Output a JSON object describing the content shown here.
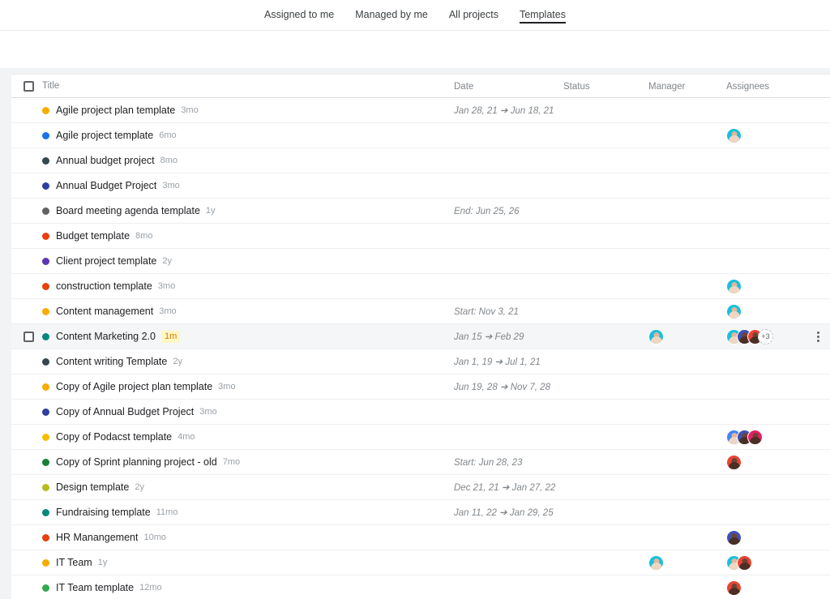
{
  "nav": {
    "tabs": [
      {
        "label": "Assigned to me",
        "active": false
      },
      {
        "label": "Managed by me",
        "active": false
      },
      {
        "label": "All projects",
        "active": false
      },
      {
        "label": "Templates",
        "active": true
      }
    ]
  },
  "table": {
    "columns": {
      "title": "Title",
      "date": "Date",
      "status": "Status",
      "manager": "Manager",
      "assignees": "Assignees"
    },
    "rows": [
      {
        "title": "Agile project plan template",
        "age": "3mo",
        "dot": "#f9ab00",
        "date": "Jan 28, 21 ➔ Jun 18, 21",
        "status": "",
        "manager": [],
        "assignees": [],
        "selected": false,
        "checkbox": false,
        "menu": false
      },
      {
        "title": "Agile project template",
        "age": "6mo",
        "dot": "#1a73e8",
        "date": "",
        "status": "",
        "manager": [],
        "assignees": [
          {
            "bg": "#19c0de",
            "tone": "light"
          }
        ],
        "selected": false,
        "checkbox": false,
        "menu": false
      },
      {
        "title": "Annual budget project",
        "age": "8mo",
        "dot": "#37474f",
        "date": "",
        "status": "",
        "manager": [],
        "assignees": [],
        "selected": false,
        "checkbox": false,
        "menu": false
      },
      {
        "title": "Annual Budget Project",
        "age": "3mo",
        "dot": "#303f9f",
        "date": "",
        "status": "",
        "manager": [],
        "assignees": [],
        "selected": false,
        "checkbox": false,
        "menu": false
      },
      {
        "title": "Board meeting agenda template",
        "age": "1y",
        "dot": "#616161",
        "date": "End: Jun 25, 26",
        "status": "",
        "manager": [],
        "assignees": [],
        "selected": false,
        "checkbox": false,
        "menu": false
      },
      {
        "title": "Budget template",
        "age": "8mo",
        "dot": "#e8400f",
        "date": "",
        "status": "",
        "manager": [],
        "assignees": [],
        "selected": false,
        "checkbox": false,
        "menu": false
      },
      {
        "title": "Client project template",
        "age": "2y",
        "dot": "#5e35b1",
        "date": "",
        "status": "",
        "manager": [],
        "assignees": [],
        "selected": false,
        "checkbox": false,
        "menu": false
      },
      {
        "title": "construction template",
        "age": "3mo",
        "dot": "#e8400f",
        "date": "",
        "status": "",
        "manager": [],
        "assignees": [
          {
            "bg": "#19c0de",
            "tone": "light"
          }
        ],
        "selected": false,
        "checkbox": false,
        "menu": false
      },
      {
        "title": "Content management",
        "age": "3mo",
        "dot": "#f9ab00",
        "date": "Start: Nov 3, 21",
        "status": "",
        "manager": [],
        "assignees": [
          {
            "bg": "#19c0de",
            "tone": "light"
          }
        ],
        "selected": false,
        "checkbox": false,
        "menu": false
      },
      {
        "title": "Content Marketing 2.0",
        "age": "1m",
        "age_badge": true,
        "dot": "#00897b",
        "date": "Jan 15 ➔ Feb 29",
        "status": "",
        "manager": [
          {
            "bg": "#19c0de",
            "tone": "light"
          }
        ],
        "assignees": [
          {
            "bg": "#19c0de",
            "tone": "light"
          },
          {
            "bg": "#3f51b5",
            "tone": "dark"
          },
          {
            "bg": "#ea4335",
            "tone": "dark"
          }
        ],
        "overflow": "+3",
        "selected": true,
        "checkbox": true,
        "menu": true
      },
      {
        "title": "Content writing Template",
        "age": "2y",
        "dot": "#37474f",
        "date": "Jan 1, 19 ➔ Jul 1, 21",
        "status": "",
        "manager": [],
        "assignees": [],
        "selected": false,
        "checkbox": false,
        "menu": false
      },
      {
        "title": "Copy of Agile project plan template",
        "age": "3mo",
        "dot": "#f9ab00",
        "date": "Jun 19, 28 ➔ Nov 7, 28",
        "status": "",
        "manager": [],
        "assignees": [],
        "selected": false,
        "checkbox": false,
        "menu": false
      },
      {
        "title": "Copy of Annual Budget Project",
        "age": "3mo",
        "dot": "#303f9f",
        "date": "",
        "status": "",
        "manager": [],
        "assignees": [],
        "selected": false,
        "checkbox": false,
        "menu": false
      },
      {
        "title": "Copy of Podacst template",
        "age": "4mo",
        "dot": "#fbbc04",
        "date": "",
        "status": "",
        "manager": [],
        "assignees": [
          {
            "bg": "#4285f4",
            "tone": "light"
          },
          {
            "bg": "#3f51b5",
            "tone": "dark"
          },
          {
            "bg": "#e91e63",
            "tone": "dark"
          }
        ],
        "selected": false,
        "checkbox": false,
        "menu": false
      },
      {
        "title": "Copy of Sprint planning project - old",
        "age": "7mo",
        "dot": "#188038",
        "date": "Start: Jun 28, 23",
        "status": "",
        "manager": [],
        "assignees": [
          {
            "bg": "#ea4335",
            "tone": "dark"
          }
        ],
        "selected": false,
        "checkbox": false,
        "menu": false
      },
      {
        "title": "Design template",
        "age": "2y",
        "dot": "#b5bd1f",
        "date": "Dec 21, 21 ➔ Jan 27, 22",
        "status": "",
        "manager": [],
        "assignees": [],
        "selected": false,
        "checkbox": false,
        "menu": false
      },
      {
        "title": "Fundraising template",
        "age": "11mo",
        "dot": "#00897b",
        "date": "Jan 11, 22 ➔ Jan 29, 25",
        "status": "",
        "manager": [],
        "assignees": [],
        "selected": false,
        "checkbox": false,
        "menu": false
      },
      {
        "title": "HR Manangement",
        "age": "10mo",
        "dot": "#e8400f",
        "date": "",
        "status": "",
        "manager": [],
        "assignees": [
          {
            "bg": "#3f51b5",
            "tone": "dark"
          }
        ],
        "selected": false,
        "checkbox": false,
        "menu": false
      },
      {
        "title": "IT Team",
        "age": "1y",
        "dot": "#f9ab00",
        "date": "",
        "status": "",
        "manager": [
          {
            "bg": "#19c0de",
            "tone": "light"
          }
        ],
        "assignees": [
          {
            "bg": "#19c0de",
            "tone": "light"
          },
          {
            "bg": "#ea4335",
            "tone": "dark"
          }
        ],
        "selected": false,
        "checkbox": false,
        "menu": false
      },
      {
        "title": "IT Team template",
        "age": "12mo",
        "dot": "#34a853",
        "date": "",
        "status": "",
        "manager": [],
        "assignees": [
          {
            "bg": "#ea4335",
            "tone": "dark"
          }
        ],
        "selected": false,
        "checkbox": false,
        "menu": false
      }
    ]
  }
}
